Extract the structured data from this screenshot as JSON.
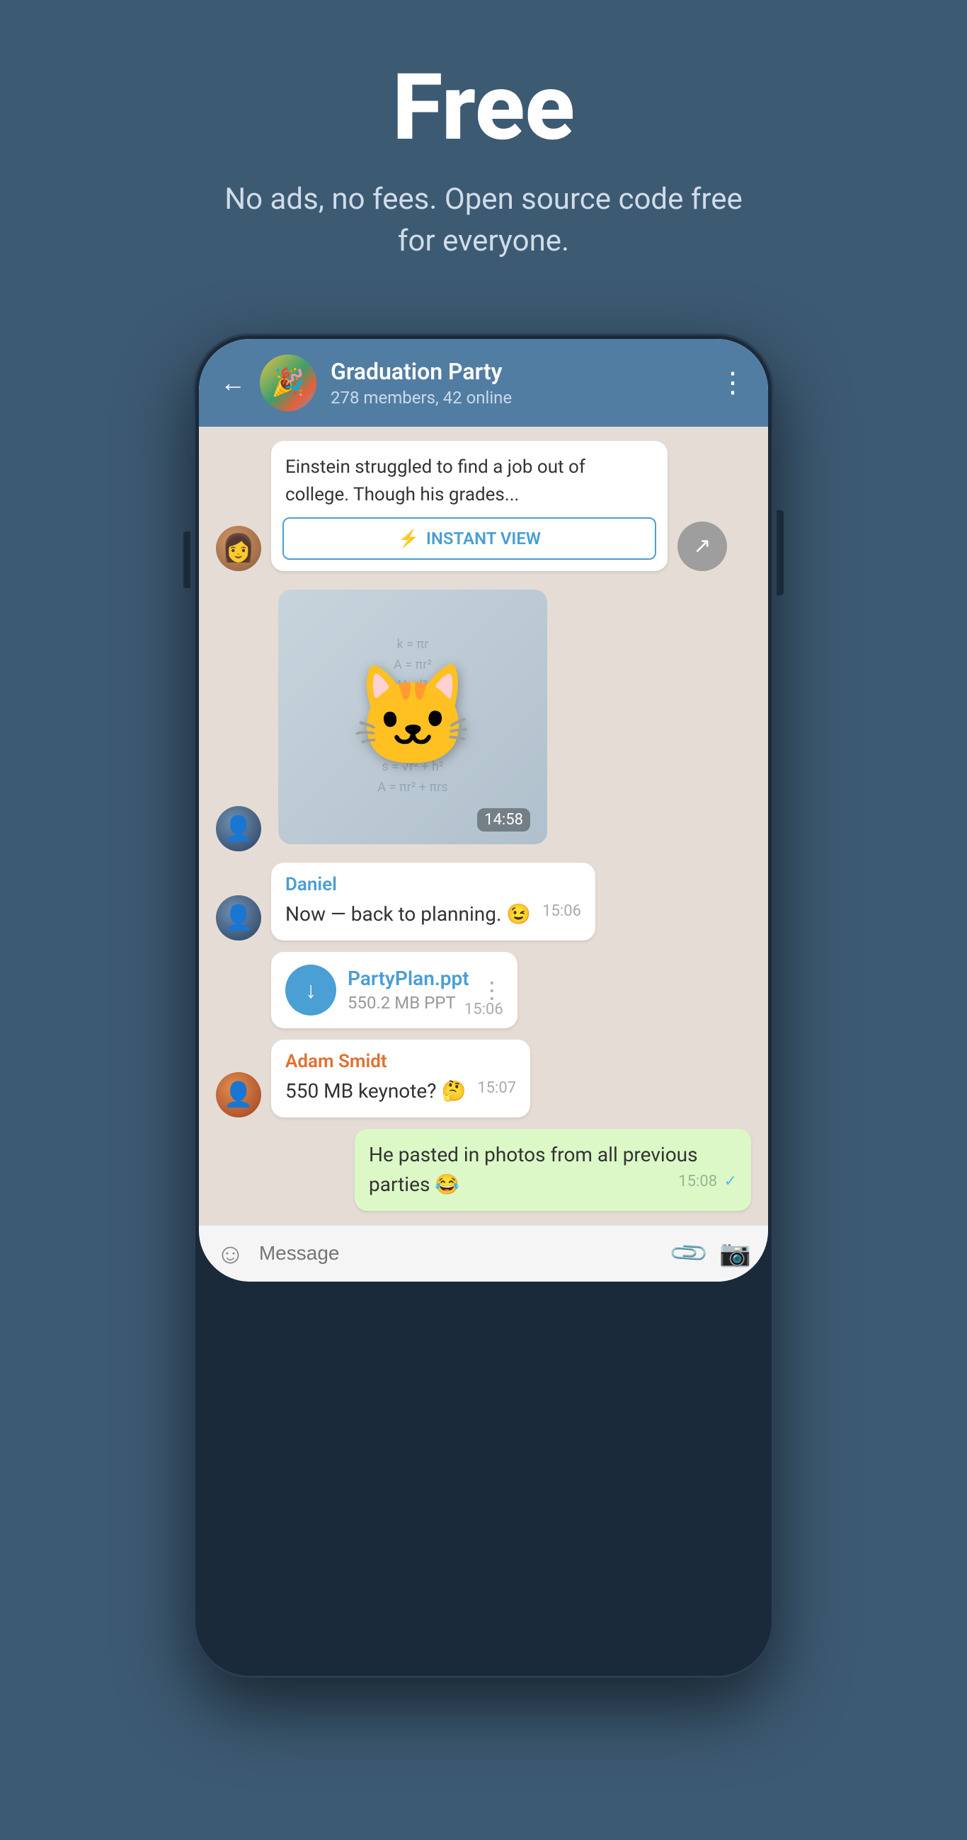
{
  "hero": {
    "title": "Free",
    "subtitle": "No ads, no fees. Open source code free for everyone."
  },
  "chat": {
    "back_label": "←",
    "group_name": "Graduation Party",
    "group_members": "278 members, 42 online",
    "more_icon": "⋮",
    "article_preview": "Einstein struggled to find a job out of college. Though his grades...",
    "instant_view_label": "INSTANT VIEW",
    "sticker_time": "14:58",
    "messages": [
      {
        "sender": "Daniel",
        "text": "Now — back to planning. 😉",
        "time": "15:06",
        "type": "text"
      },
      {
        "file_name": "PartyPlan.ppt",
        "file_size": "550.2 MB PPT",
        "time": "15:06",
        "type": "file"
      },
      {
        "sender": "Adam Smidt",
        "text": "550 MB keynote? 🤔",
        "time": "15:07",
        "type": "text"
      },
      {
        "text": "He pasted in photos from all previous parties 😂",
        "time": "15:08",
        "type": "self"
      }
    ],
    "input_placeholder": "Message"
  }
}
